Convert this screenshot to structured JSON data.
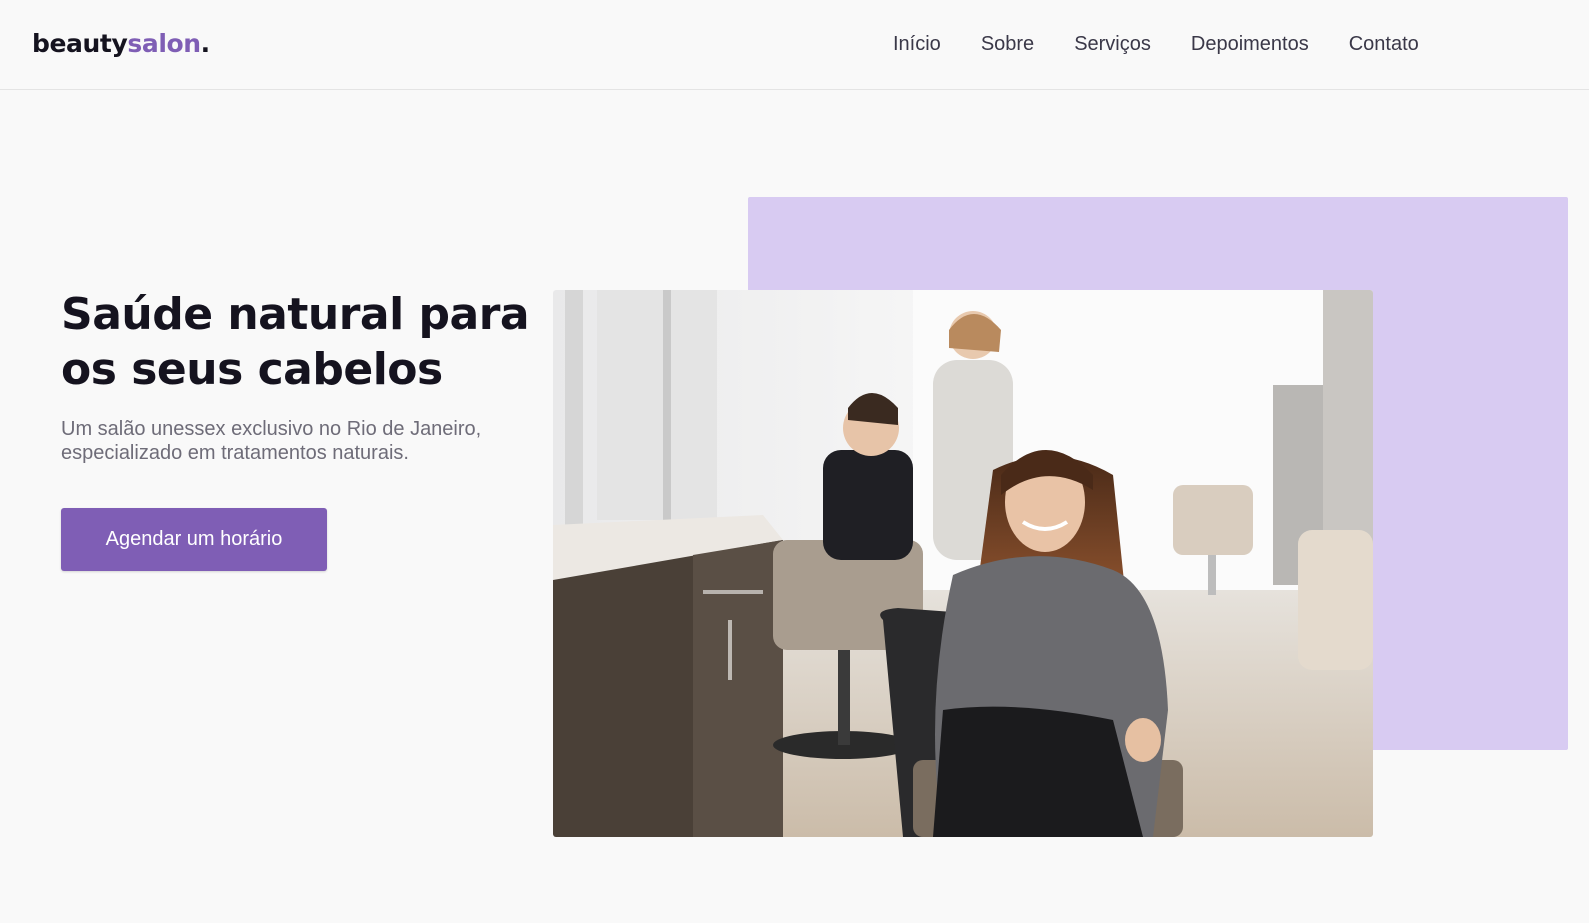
{
  "header": {
    "logo_main": "beauty",
    "logo_accent": "salon",
    "logo_dot": ".",
    "nav": [
      {
        "label": "Início"
      },
      {
        "label": "Sobre"
      },
      {
        "label": "Serviços"
      },
      {
        "label": "Depoimentos"
      },
      {
        "label": "Contato"
      }
    ]
  },
  "hero": {
    "title": "Saúde natural para os seus cabelos",
    "subtitle": "Um salão unessex exclusivo no Rio de Janeiro, especializado em tratamentos naturais.",
    "cta_label": "Agendar um horário"
  },
  "colors": {
    "accent": "#7f5eb5",
    "accent_light": "#d8cbf2",
    "background": "#f9f9f9",
    "text_dark": "#15131f"
  }
}
